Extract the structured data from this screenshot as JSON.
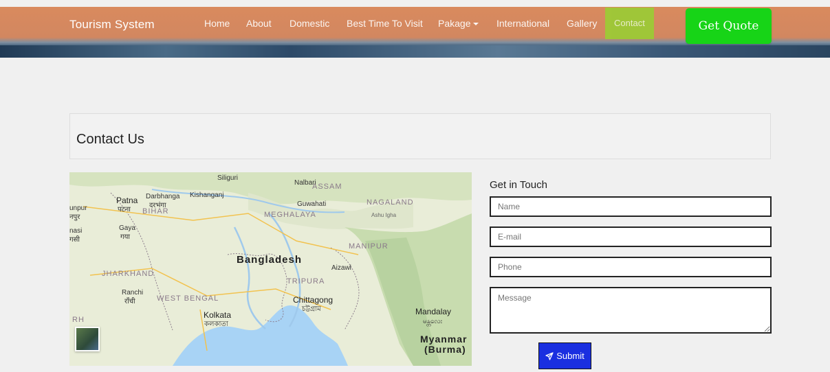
{
  "navbar": {
    "brand": "Tourism System",
    "items": [
      {
        "label": "Home"
      },
      {
        "label": "About"
      },
      {
        "label": "Domestic"
      },
      {
        "label": "Best Time To Visit"
      },
      {
        "label": "Pakage"
      },
      {
        "label": "International"
      },
      {
        "label": "Gallery"
      },
      {
        "label": "Contact",
        "active": true
      }
    ],
    "quote_button": "Get Quote",
    "colors": {
      "bar": "#d28760",
      "active": "#9bcc35",
      "quote": "#17d417"
    }
  },
  "contact": {
    "title": "Contact Us"
  },
  "map": {
    "labels": {
      "siliguri": "Siliguri",
      "nalbari": "Nalbari",
      "assam": "ASSAM",
      "patna": "Patna",
      "patna_hi": "पटना",
      "darbhanga": "Darbhanga",
      "darbhanga_hi": "दरभंगा",
      "kishanganj": "Kishanganj",
      "guwahati": "Guwahati",
      "nagaland": "NAGALAND",
      "jaunpur": "unpur",
      "jaunpur_hi": "नपुर",
      "bihar": "BIHAR",
      "meghalaya": "MEGHALAYA",
      "ashu": "Ashu Igha",
      "gaya": "Gaya",
      "gaya_hi": "गया",
      "nasi": "nasi",
      "nasi_hi": "गसी",
      "manipur": "MANIPUR",
      "bangladesh": "Bangladesh",
      "aizawl": "Aizawl",
      "jharkhand": "JHARKHAND",
      "tripura": "TRIPURA",
      "ranchi": "Ranchi",
      "ranchi_hi": "राँची",
      "west_bengal": "WEST BENGAL",
      "chittagong": "Chittagong",
      "chittagong_bn": "চট্টগ্রাম",
      "mandalay": "Mandalay",
      "mandalay_my": "မန္တလေး",
      "rh": "RH",
      "kolkata": "Kolkata",
      "kolkata_bn": "কলকাতা",
      "myanmar": "Myanmar",
      "burma": "(Burma)"
    }
  },
  "form": {
    "title": "Get in Touch",
    "name_placeholder": "Name",
    "email_placeholder": "E-mail",
    "phone_placeholder": "Phone",
    "message_placeholder": "Message",
    "submit_label": "Submit"
  }
}
